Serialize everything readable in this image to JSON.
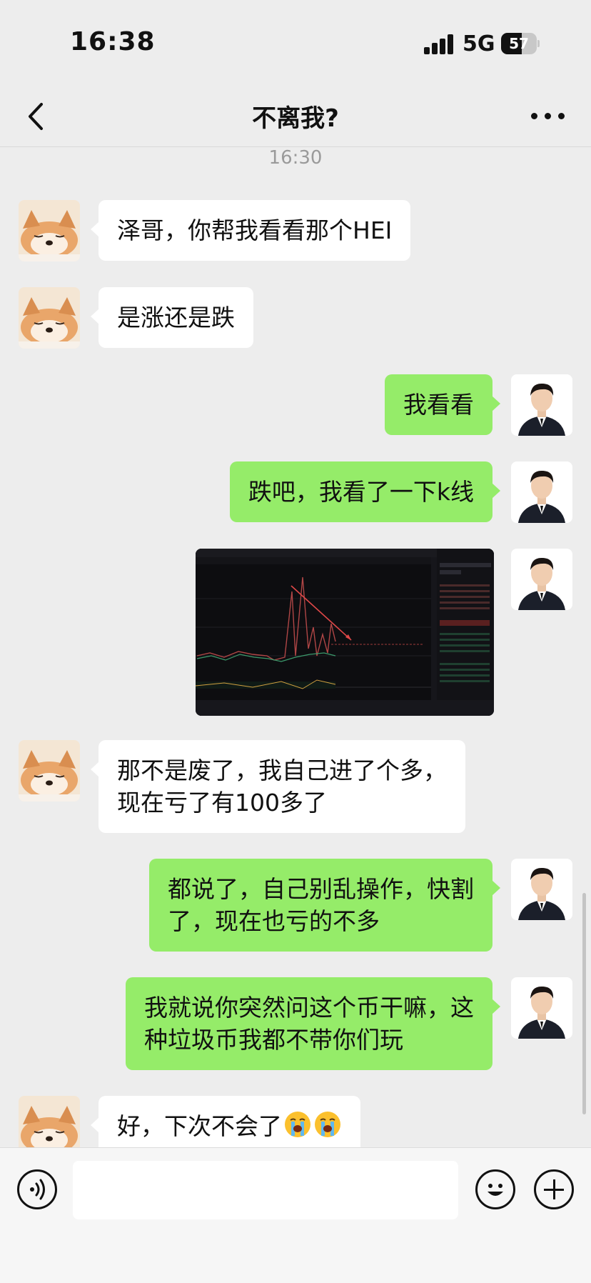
{
  "status_bar": {
    "time": "16:38",
    "network": "5G",
    "battery": "57",
    "battery_level": 0.57
  },
  "header": {
    "title": "不离我?"
  },
  "chat": {
    "timestamp": "16:30",
    "messages": [
      {
        "side": "in",
        "text": "泽哥，你帮我看看那个HEI"
      },
      {
        "side": "in",
        "text": "是涨还是跌"
      },
      {
        "side": "out",
        "text": "我看看"
      },
      {
        "side": "out",
        "text": "跌吧，我看了一下k线"
      },
      {
        "side": "out",
        "type": "image",
        "image": "trading-chart-screenshot"
      },
      {
        "side": "in",
        "line1": "那不是废了，我自己进了个多，",
        "line2": "现在亏了有100多了"
      },
      {
        "side": "out",
        "line1": "都说了，自己别乱操作，快割",
        "line2": "了，现在也亏的不多"
      },
      {
        "side": "out",
        "line1": "我就说你突然问这个币干嘛，这",
        "line2": "种垃圾币我都不带你们玩"
      },
      {
        "side": "in",
        "text": "好，下次不会了",
        "emojis": [
          "loudly-crying-face",
          "loudly-crying-face"
        ]
      }
    ]
  },
  "input_bar": {
    "voice_icon": "voice-icon",
    "emoji_icon": "smiley-icon",
    "plus_icon": "plus-icon"
  }
}
